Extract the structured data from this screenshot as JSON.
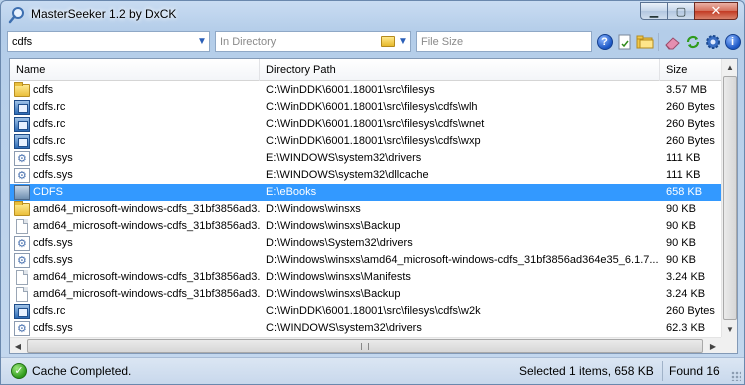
{
  "window": {
    "title": "MasterSeeker 1.2 by DxCK"
  },
  "search": {
    "name_value": "cdfs",
    "directory_placeholder": "In Directory",
    "size_placeholder": "File Size"
  },
  "columns": {
    "name": "Name",
    "directory": "Directory Path",
    "size": "Size"
  },
  "rows": [
    {
      "icon": "folder-icon",
      "name": "cdfs",
      "dir": "C:\\WinDDK\\6001.18001\\src\\filesys",
      "size": "3.57 MB",
      "selected": false
    },
    {
      "icon": "rc-file-icon",
      "name": "cdfs.rc",
      "dir": "C:\\WinDDK\\6001.18001\\src\\filesys\\cdfs\\wlh",
      "size": "260 Bytes",
      "selected": false
    },
    {
      "icon": "rc-file-icon",
      "name": "cdfs.rc",
      "dir": "C:\\WinDDK\\6001.18001\\src\\filesys\\cdfs\\wnet",
      "size": "260 Bytes",
      "selected": false
    },
    {
      "icon": "rc-file-icon",
      "name": "cdfs.rc",
      "dir": "C:\\WinDDK\\6001.18001\\src\\filesys\\cdfs\\wxp",
      "size": "260 Bytes",
      "selected": false
    },
    {
      "icon": "sys-file-icon",
      "name": "cdfs.sys",
      "dir": "E:\\WINDOWS\\system32\\drivers",
      "size": "111 KB",
      "selected": false
    },
    {
      "icon": "sys-file-icon",
      "name": "cdfs.sys",
      "dir": "E:\\WINDOWS\\system32\\dllcache",
      "size": "111 KB",
      "selected": false
    },
    {
      "icon": "directory-icon",
      "name": "CDFS",
      "dir": "E:\\eBooks",
      "size": "658 KB",
      "selected": true
    },
    {
      "icon": "folder-icon",
      "name": "amd64_microsoft-windows-cdfs_31bf3856ad3...",
      "dir": "D:\\Windows\\winsxs",
      "size": "90 KB",
      "selected": false
    },
    {
      "icon": "file-icon",
      "name": "amd64_microsoft-windows-cdfs_31bf3856ad3...",
      "dir": "D:\\Windows\\winsxs\\Backup",
      "size": "90 KB",
      "selected": false
    },
    {
      "icon": "sys-file-icon",
      "name": "cdfs.sys",
      "dir": "D:\\Windows\\System32\\drivers",
      "size": "90 KB",
      "selected": false
    },
    {
      "icon": "sys-file-icon",
      "name": "cdfs.sys",
      "dir": "D:\\Windows\\winsxs\\amd64_microsoft-windows-cdfs_31bf3856ad364e35_6.1.7...",
      "size": "90 KB",
      "selected": false
    },
    {
      "icon": "file-icon",
      "name": "amd64_microsoft-windows-cdfs_31bf3856ad3...",
      "dir": "D:\\Windows\\winsxs\\Manifests",
      "size": "3.24 KB",
      "selected": false
    },
    {
      "icon": "file-icon",
      "name": "amd64_microsoft-windows-cdfs_31bf3856ad3...",
      "dir": "D:\\Windows\\winsxs\\Backup",
      "size": "3.24 KB",
      "selected": false
    },
    {
      "icon": "rc-file-icon",
      "name": "cdfs.rc",
      "dir": "C:\\WinDDK\\6001.18001\\src\\filesys\\cdfs\\w2k",
      "size": "260 Bytes",
      "selected": false
    },
    {
      "icon": "sys-file-icon",
      "name": "cdfs.sys",
      "dir": "C:\\WINDOWS\\system32\\drivers",
      "size": "62.3 KB",
      "selected": false
    }
  ],
  "status": {
    "message": "Cache Completed.",
    "selection": "Selected 1 items, 658 KB",
    "found": "Found 16"
  },
  "colors": {
    "selection": "#3399ff",
    "titlebar": "#b9d1ea"
  }
}
